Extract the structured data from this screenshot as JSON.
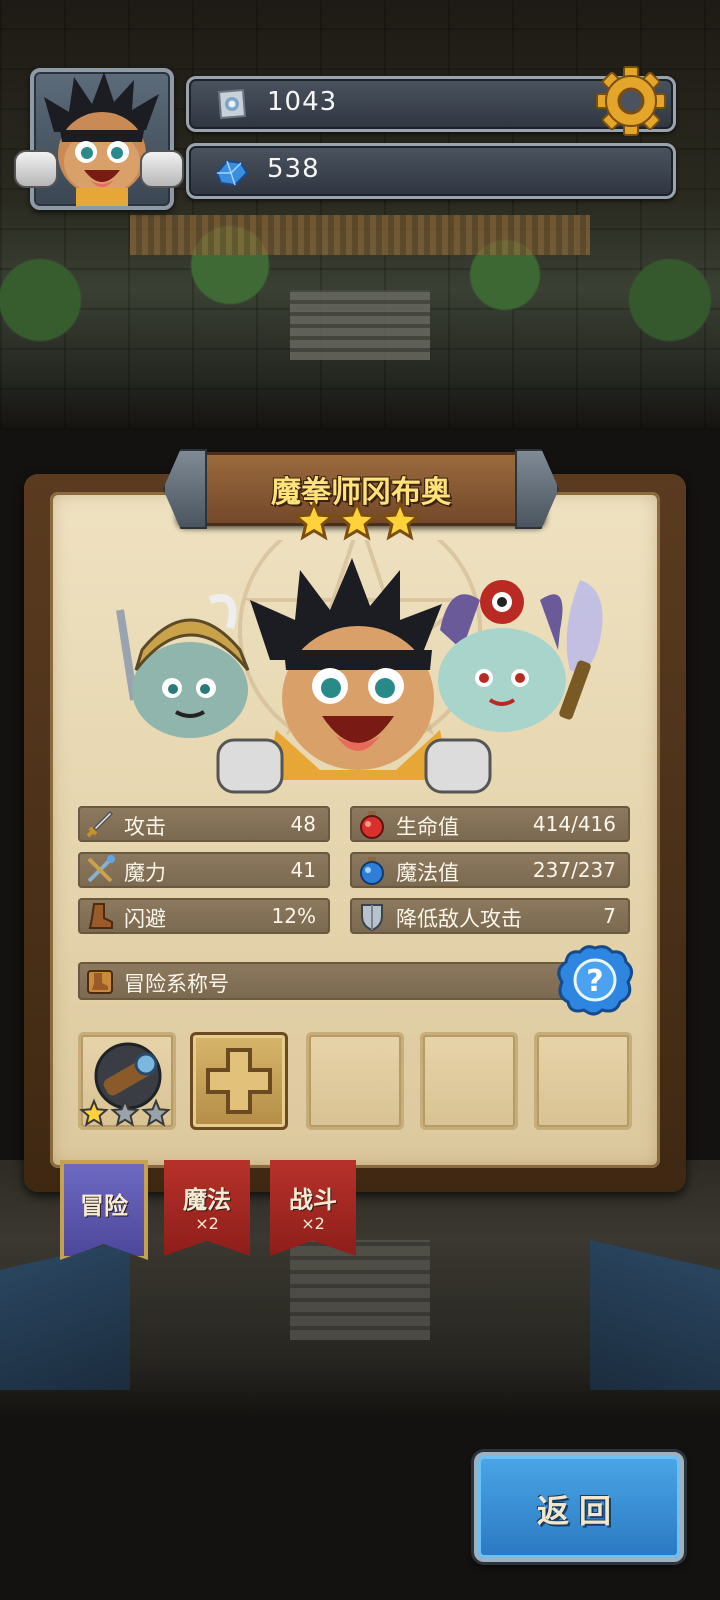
{
  "hud": {
    "currency1_value": "1043",
    "currency1_icon": "silver-token-icon",
    "currency2_value": "538",
    "currency2_icon": "blue-gem-icon",
    "settings_icon": "gear-icon"
  },
  "hero": {
    "name": "魔拳师冈布奥",
    "rank_stars": 3
  },
  "stats": {
    "attack": {
      "label": "攻击",
      "value": "48",
      "icon": "sword-icon"
    },
    "magic": {
      "label": "魔力",
      "value": "41",
      "icon": "crossed-wand-icon"
    },
    "dodge": {
      "label": "闪避",
      "value": "12%",
      "icon": "boot-icon"
    },
    "hp": {
      "label": "生命值",
      "value": "414/416",
      "icon": "red-potion-icon"
    },
    "mp": {
      "label": "魔法值",
      "value": "237/237",
      "icon": "blue-potion-icon"
    },
    "defense": {
      "label": "降低敌人攻击",
      "value": "7",
      "icon": "shield-icon"
    }
  },
  "title_row": {
    "label": "冒险系称号",
    "icon": "boot-scroll-icon",
    "help": "?"
  },
  "slots": {
    "equipped_stars_filled": 1,
    "equipped_stars_total": 3,
    "equipped_icon": "telescope-icon",
    "add_icon": "plus-icon"
  },
  "tabs": [
    {
      "label": "冒险",
      "multiplier": ""
    },
    {
      "label": "魔法",
      "multiplier": "×2"
    },
    {
      "label": "战斗",
      "multiplier": "×2"
    }
  ],
  "back_label": "返回",
  "colors": {
    "panel_parchment": "#e4d3ac",
    "tab_active": "#5b57b0",
    "tab_inactive": "#a1271f",
    "back_button": "#3a90d8",
    "title_gold": "#ffe27a"
  }
}
